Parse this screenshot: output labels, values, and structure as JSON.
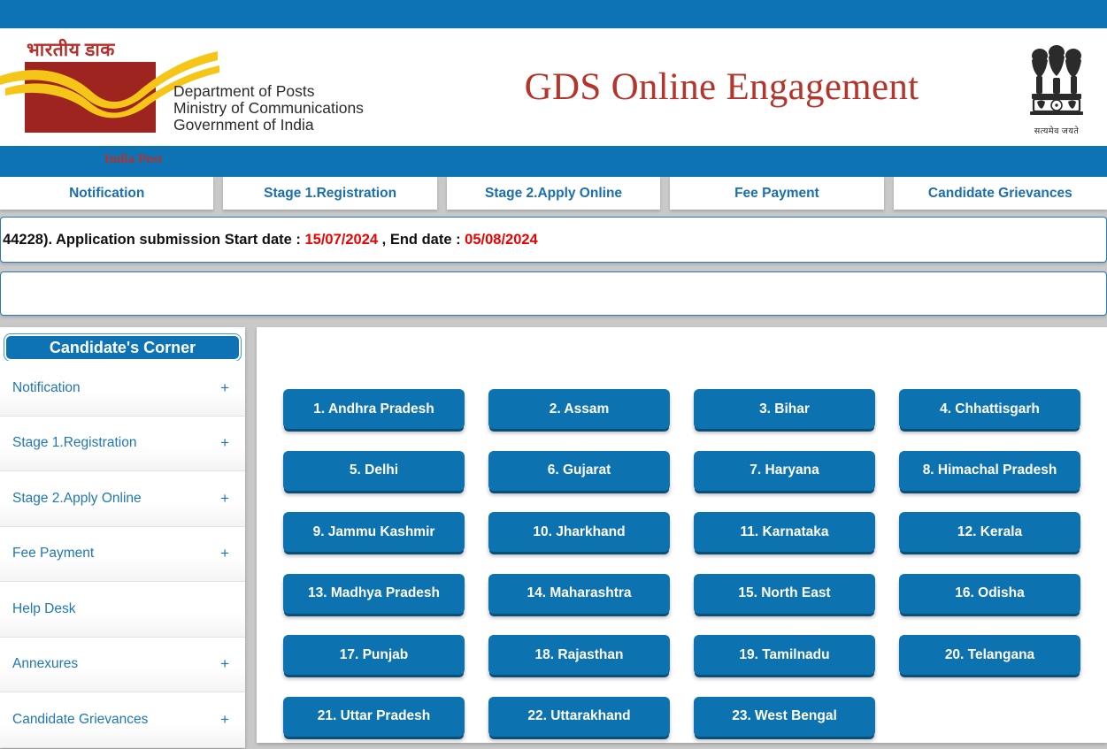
{
  "header": {
    "title": "GDS Online Engagement",
    "logo": {
      "hindi": "भारतीय डाक",
      "india_post": "India Post",
      "department_lines": "Department of Posts\nMinistry of Communications\nGovernment of India"
    },
    "emblem": {
      "icon": "ashoka-lion-capital-icon",
      "caption": "सत्यमेव जयते"
    }
  },
  "tabs": [
    {
      "label": "Notification"
    },
    {
      "label": "Stage 1.Registration"
    },
    {
      "label": "Stage 2.Apply Online"
    },
    {
      "label": "Fee Payment"
    },
    {
      "label": "Candidate Grievances"
    }
  ],
  "marquee": {
    "prefix": ": 44228). Application submission Start date : ",
    "start_date": "15/07/2024",
    "middle": " , End date : ",
    "end_date": "05/08/2024",
    "date_color": "#ee0000"
  },
  "notice_box": {
    "text": ""
  },
  "sidebar": {
    "title": "Candidate's Corner",
    "items": [
      {
        "label": "Notification",
        "expander": "+"
      },
      {
        "label": "Stage 1.Registration",
        "expander": "+"
      },
      {
        "label": "Stage 2.Apply Online",
        "expander": "+"
      },
      {
        "label": "Fee Payment",
        "expander": "+"
      },
      {
        "label": "Help Desk",
        "expander": ""
      },
      {
        "label": "Annexures",
        "expander": "+"
      },
      {
        "label": "Candidate Grievances",
        "expander": "+"
      }
    ]
  },
  "content": {
    "states": [
      {
        "label": "1. Andhra Pradesh"
      },
      {
        "label": "2. Assam"
      },
      {
        "label": "3. Bihar"
      },
      {
        "label": "4. Chhattisgarh"
      },
      {
        "label": "5. Delhi"
      },
      {
        "label": "6. Gujarat"
      },
      {
        "label": "7. Haryana"
      },
      {
        "label": "8. Himachal Pradesh"
      },
      {
        "label": "9. Jammu Kashmir"
      },
      {
        "label": "10. Jharkhand"
      },
      {
        "label": "11. Karnataka"
      },
      {
        "label": "12. Kerala"
      },
      {
        "label": "13. Madhya Pradesh"
      },
      {
        "label": "14. Maharashtra"
      },
      {
        "label": "15. North East"
      },
      {
        "label": "16. Odisha"
      },
      {
        "label": "17. Punjab"
      },
      {
        "label": "18. Rajasthan"
      },
      {
        "label": "19. Tamilnadu"
      },
      {
        "label": "20. Telangana"
      },
      {
        "label": "21. Uttar Pradesh"
      },
      {
        "label": "22. Uttarakhand"
      },
      {
        "label": "23. West Bengal"
      }
    ]
  },
  "colors": {
    "brand_blue": "#0d73b4",
    "button_blue": "#0d72b0",
    "title_red": "#b4352c",
    "logo_maroon": "#9e2420",
    "logo_yellow": "#f5c518"
  }
}
